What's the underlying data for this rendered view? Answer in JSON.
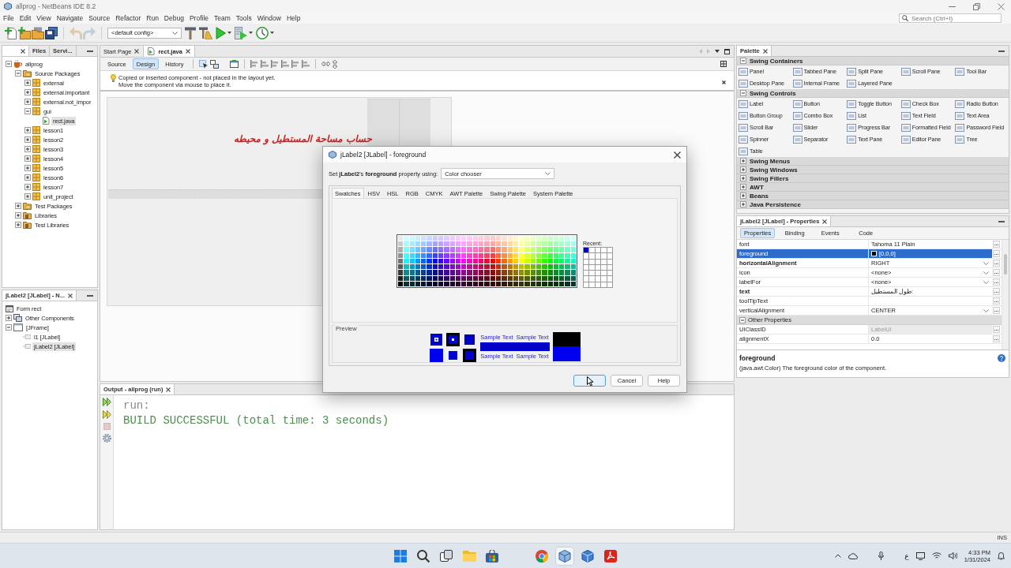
{
  "window": {
    "title": "allprog - NetBeans IDE 8.2"
  },
  "menu_bar": {
    "items": [
      "File",
      "Edit",
      "View",
      "Navigate",
      "Source",
      "Refactor",
      "Run",
      "Debug",
      "Profile",
      "Team",
      "Tools",
      "Window",
      "Help"
    ],
    "search": {
      "placeholder": "Search (Ctrl+I)"
    }
  },
  "toolbar": {
    "file_buttons": [
      {
        "kind": "new-file",
        "disabled": false
      },
      {
        "kind": "new-project",
        "disabled": false
      },
      {
        "kind": "open-project",
        "disabled": false
      },
      {
        "kind": "save-all",
        "disabled": false
      },
      {
        "kind": "undo",
        "disabled": true
      },
      {
        "kind": "redo",
        "disabled": true
      }
    ],
    "config": "<default config>",
    "run_buttons": [
      {
        "kind": "build",
        "menu": false
      },
      {
        "kind": "clean-build",
        "menu": false
      },
      {
        "kind": "run",
        "menu": true
      },
      {
        "kind": "debug",
        "menu": true
      },
      {
        "kind": "profile",
        "menu": true
      }
    ]
  },
  "projects_panel": {
    "tabs": [
      {
        "selected": true
      },
      {
        "label": "Files",
        "selected": false
      },
      {
        "label": "Servi...",
        "selected": false
      }
    ],
    "tree": [
      {
        "label": "allprog",
        "kind": "project",
        "expanded": true,
        "selected": false,
        "children": [
          {
            "label": "Source Packages",
            "kind": "source-folder",
            "expanded": true,
            "selected": false,
            "children": [
              {
                "label": "external",
                "kind": "package",
                "expanded": false,
                "selected": false
              },
              {
                "label": "external.important",
                "kind": "package",
                "expanded": false,
                "selected": false
              },
              {
                "label": "external.not_impor",
                "kind": "package",
                "expanded": false,
                "selected": false
              },
              {
                "label": "gui",
                "kind": "package",
                "expanded": true,
                "selected": false,
                "children": [
                  {
                    "label": "rect.java",
                    "kind": "java-file",
                    "selected": true
                  }
                ]
              },
              {
                "label": "lesson1",
                "kind": "package",
                "expanded": false,
                "selected": false
              },
              {
                "label": "lesson2",
                "kind": "package",
                "expanded": false,
                "selected": false
              },
              {
                "label": "lesson3",
                "kind": "package",
                "expanded": false,
                "selected": false
              },
              {
                "label": "lesson4",
                "kind": "package",
                "expanded": false,
                "selected": false
              },
              {
                "label": "lesson5",
                "kind": "package",
                "expanded": false,
                "selected": false
              },
              {
                "label": "lesson6",
                "kind": "package",
                "expanded": false,
                "selected": false
              },
              {
                "label": "lesson7",
                "kind": "package",
                "expanded": false,
                "selected": false
              },
              {
                "label": "unit_project",
                "kind": "package",
                "expanded": false,
                "selected": false
              }
            ]
          },
          {
            "label": "Test Packages",
            "kind": "source-folder",
            "expanded": false,
            "selected": false
          },
          {
            "label": "Libraries",
            "kind": "library",
            "expanded": false,
            "selected": false
          },
          {
            "label": "Test Libraries",
            "kind": "library",
            "expanded": false,
            "selected": false
          }
        ]
      }
    ]
  },
  "navigator": {
    "tab": "jLabel2 [JLabel] - N...",
    "tree": [
      {
        "label": "Form rect",
        "kind": "form",
        "selected": false,
        "children": [
          {
            "label": "Other Components",
            "kind": "components",
            "expanded": false,
            "selected": false
          },
          {
            "label": "[JFrame]",
            "kind": "frame",
            "expanded": true,
            "selected": false,
            "children": [
              {
                "label": "l1 [JLabel]",
                "kind": "label",
                "selected": false
              },
              {
                "label": "jLabel2 [JLabel]",
                "kind": "label",
                "selected": true
              }
            ]
          }
        ]
      }
    ]
  },
  "editor": {
    "tabs": [
      {
        "label": "Start Page",
        "kind": "page",
        "selected": false
      },
      {
        "label": "rect.java",
        "kind": "java-file",
        "selected": true
      }
    ],
    "views": [
      {
        "label": "Source",
        "selected": false
      },
      {
        "label": "Design",
        "selected": true
      },
      {
        "label": "History",
        "selected": false
      }
    ],
    "notice": [
      "Copied or inserted component - not placed in the layout yet.",
      "Move the component via mouse to place it."
    ],
    "form": {
      "heading": "حساب مساحة المستطيل و محيطه"
    }
  },
  "output": {
    "tab": "Output - allprog (run)",
    "lines": [
      {
        "kind": "plain",
        "text": "run:"
      },
      {
        "kind": "success",
        "text": "BUILD SUCCESSFUL (total time: 3 seconds)"
      }
    ]
  },
  "palette": {
    "title": "Palette",
    "categories": [
      {
        "label": "Swing Containers",
        "expanded": true,
        "items": [
          "Panel",
          "Tabbed Pane",
          "Split Pane",
          "Scroll Pane",
          "Tool Bar",
          "Desktop Pane",
          "Internal Frame",
          "Layered Pane"
        ]
      },
      {
        "label": "Swing Controls",
        "expanded": true,
        "items": [
          "Label",
          "Button",
          "Toggle Button",
          "Check Box",
          "Radio Button",
          "Button Group",
          "Combo Box",
          "List",
          "Text Field",
          "Text Area",
          "Scroll Bar",
          "Slider",
          "Progress Bar",
          "Formatted Field",
          "Password Field",
          "Spinner",
          "Separator",
          "Text Pane",
          "Editor Pane",
          "Tree",
          "Table"
        ]
      },
      {
        "label": "Swing Menus",
        "expanded": false
      },
      {
        "label": "Swing Windows",
        "expanded": false
      },
      {
        "label": "Swing Fillers",
        "expanded": false
      },
      {
        "label": "AWT",
        "expanded": false
      },
      {
        "label": "Beans",
        "expanded": false
      },
      {
        "label": "Java Persistence",
        "expanded": false
      }
    ]
  },
  "properties": {
    "title": "jLabel2 [JLabel] - Properties",
    "tabs": [
      {
        "label": "Properties",
        "selected": true
      },
      {
        "label": "Binding",
        "selected": false
      },
      {
        "label": "Events",
        "selected": false
      },
      {
        "label": "Code",
        "selected": false
      }
    ],
    "rows": [
      {
        "kind": "text",
        "name": "font",
        "value": "Tahoma 11 Plain",
        "modified": false,
        "read_only": false,
        "selected": false
      },
      {
        "kind": "color",
        "name": "foreground",
        "value": "[0,0,0]",
        "color": "#000000",
        "modified": false,
        "read_only": false,
        "selected": true
      },
      {
        "kind": "choice",
        "name": "horizontalAlignment",
        "value": "RIGHT",
        "modified": true,
        "read_only": false,
        "selected": false
      },
      {
        "kind": "choice",
        "name": "icon",
        "value": "<none>",
        "modified": false,
        "read_only": false,
        "selected": false
      },
      {
        "kind": "choice",
        "name": "labelFor",
        "value": "<none>",
        "modified": false,
        "read_only": false,
        "selected": false
      },
      {
        "kind": "text",
        "name": "text",
        "value": "طول المستطيل:",
        "modified": true,
        "read_only": false,
        "selected": false
      },
      {
        "kind": "text",
        "name": "toolTipText",
        "modified": false,
        "read_only": false,
        "selected": false
      },
      {
        "kind": "choice",
        "name": "verticalAlignment",
        "value": "CENTER",
        "modified": false,
        "read_only": false,
        "selected": false
      },
      {
        "kind": "section",
        "name": "Other Properties",
        "expanded": true
      },
      {
        "kind": "text",
        "name": "UIClassID",
        "value": "LabelUI",
        "modified": false,
        "read_only": true,
        "selected": false
      },
      {
        "kind": "text",
        "name": "alignmentX",
        "value": "0.0",
        "modified": false,
        "read_only": false,
        "selected": false
      }
    ],
    "description": {
      "title": "foreground",
      "text": "(java.awt.Color) The foreground color of the component."
    }
  },
  "dialog": {
    "title": "jLabel2 [JLabel] - foreground",
    "prompt": "Set **jLabel2**'s **foreground** property using:",
    "editor_type": "Color chooser",
    "tabs": [
      {
        "label": "Swatches",
        "selected": true
      },
      {
        "label": "HSV",
        "selected": false
      },
      {
        "label": "HSL",
        "selected": false
      },
      {
        "label": "RGB",
        "selected": false
      },
      {
        "label": "CMYK",
        "selected": false
      },
      {
        "label": "AWT Palette",
        "selected": false
      },
      {
        "label": "Swing Palette",
        "selected": false
      },
      {
        "label": "System Palette",
        "selected": false
      }
    ],
    "recent": {
      "label": "Recent:",
      "colors": [
        {
          "color": "#0000cc"
        }
      ]
    },
    "preview": {
      "label": "Preview",
      "sample_lines": [
        [
          "Sample Text",
          "Sample Text"
        ],
        [
          "Sample Text",
          "Sample Text"
        ]
      ]
    },
    "buttons": [
      {
        "kind": "default",
        "covered": true
      },
      {
        "kind": "normal",
        "label": "Cancel",
        "covered": false
      },
      {
        "kind": "normal",
        "label": "Help",
        "covered": false
      }
    ]
  },
  "status_bar": {
    "mode": "INS"
  },
  "taskbar": {
    "apps": [
      {
        "kind": "start",
        "active": false
      },
      {
        "kind": "search",
        "active": false
      },
      {
        "kind": "task-view",
        "active": false
      },
      {
        "kind": "explorer",
        "active": false
      },
      {
        "kind": "store",
        "active": false
      },
      {
        "kind": "browser",
        "active": false
      },
      {
        "kind": "ide",
        "active": true
      },
      {
        "kind": "ide-alt",
        "active": false
      },
      {
        "kind": "pdf",
        "active": false
      }
    ],
    "language": "ع",
    "clock": {
      "time": "4:33 PM",
      "date": "1/31/2024"
    }
  }
}
